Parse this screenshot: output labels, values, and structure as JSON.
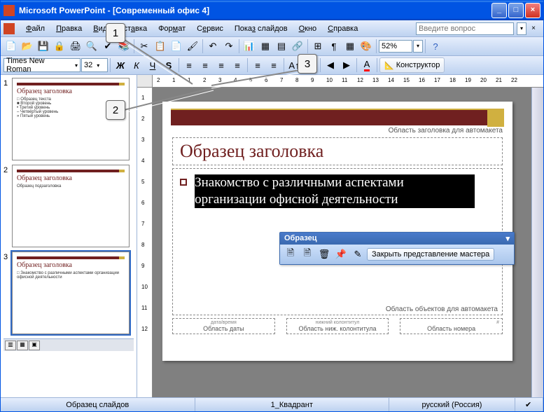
{
  "app": {
    "title": "Microsoft PowerPoint - [Современный офис 4]"
  },
  "menu": {
    "file": "Файл",
    "edit": "Правка",
    "view": "Вид",
    "insert": "Вставка",
    "format": "Формат",
    "tools": "Сервис",
    "slideshow": "Показ слайдов",
    "window": "Окно",
    "help": "Справка"
  },
  "question_placeholder": "Введите вопрос",
  "font": {
    "name": "Times New Roman",
    "size": "32"
  },
  "zoom": "52%",
  "designer_btn": "Конструктор",
  "ruler_h": [
    "2",
    "1",
    "1",
    "2",
    "3",
    "4",
    "5",
    "6",
    "7",
    "8",
    "9",
    "10",
    "11",
    "12",
    "13",
    "14",
    "15",
    "16",
    "17",
    "18",
    "19",
    "20",
    "21",
    "22"
  ],
  "ruler_v": [
    "1",
    "2",
    "3",
    "4",
    "5",
    "6",
    "7",
    "8",
    "9",
    "10",
    "11",
    "12"
  ],
  "thumbs": [
    {
      "n": "1",
      "title": "Образец заголовка",
      "body": "□ Образец текста\n  ■ Второй уровень\n    • Третий уровень\n      – Четвёртый уровень\n        » Пятый уровень"
    },
    {
      "n": "2",
      "title": "Образец заголовка",
      "body": "Образец подзаголовка"
    },
    {
      "n": "3",
      "title": "Образец заголовка",
      "body": "□ Знакомство с различными аспектами организации офисной деятельности"
    }
  ],
  "slide": {
    "header_label": "Область заголовка для автомакета",
    "title": "Образец заголовка",
    "body_text": "Знакомство с различными аспектами организации офисной деятельности",
    "body_label": "Область объектов для автомакета",
    "footers": {
      "date_sm": "дата/время",
      "date": "Область даты",
      "ftr_sm": "нижний колонтитул",
      "ftr": "Область ниж. колонтитула",
      "num_sm": "#",
      "num": "Область номера"
    }
  },
  "master_toolbar": {
    "title": "Образец",
    "close": "Закрыть представление мастера"
  },
  "status": {
    "left": "Образец слайдов",
    "theme": "1_Квадрант",
    "lang": "русский (Россия)"
  },
  "callouts": {
    "c1": "1",
    "c2": "2",
    "c3": "3"
  }
}
